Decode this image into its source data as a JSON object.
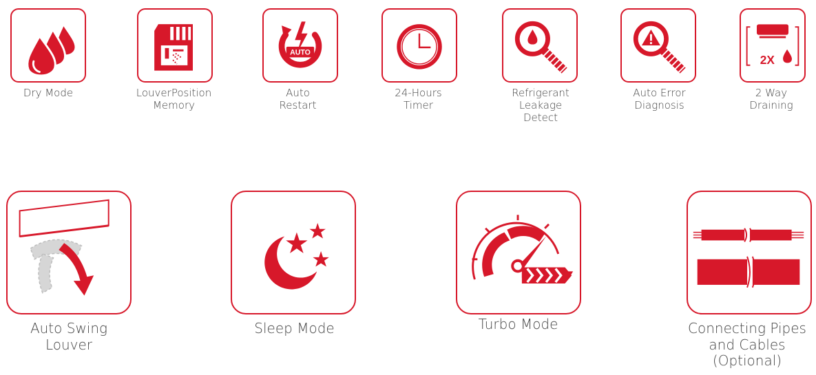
{
  "colors": {
    "accent": "#d7182a",
    "text": "#444444"
  },
  "features_top": [
    {
      "icon": "dry-mode-icon",
      "lines": [
        "Dry Mode"
      ]
    },
    {
      "icon": "louver-memory-icon",
      "lines": [
        "LouverPosition",
        "Memory"
      ]
    },
    {
      "icon": "auto-restart-icon",
      "lines": [
        "Auto",
        "Restart"
      ]
    },
    {
      "icon": "timer-icon",
      "lines": [
        "24-Hours",
        "Timer"
      ]
    },
    {
      "icon": "refrigerant-leak-icon",
      "lines": [
        "Refrigerant",
        "Leakage",
        "Detect"
      ]
    },
    {
      "icon": "error-diagnosis-icon",
      "lines": [
        "Auto Error",
        "Diagnosis"
      ]
    },
    {
      "icon": "two-way-drain-icon",
      "lines": [
        "2 Way",
        "Draining"
      ]
    }
  ],
  "features_bottom": [
    {
      "icon": "auto-swing-icon",
      "lines": [
        "Auto Swing",
        "Louver"
      ]
    },
    {
      "icon": "sleep-mode-icon",
      "lines": [
        "Sleep Mode"
      ]
    },
    {
      "icon": "turbo-mode-icon",
      "lines": [
        "Turbo Mode"
      ]
    },
    {
      "icon": "pipes-cables-icon",
      "lines": [
        "Connecting Pipes",
        "and Cables",
        "(Optional)"
      ]
    }
  ],
  "icon_text": {
    "auto_badge": "AUTO",
    "two_x": "2X"
  }
}
